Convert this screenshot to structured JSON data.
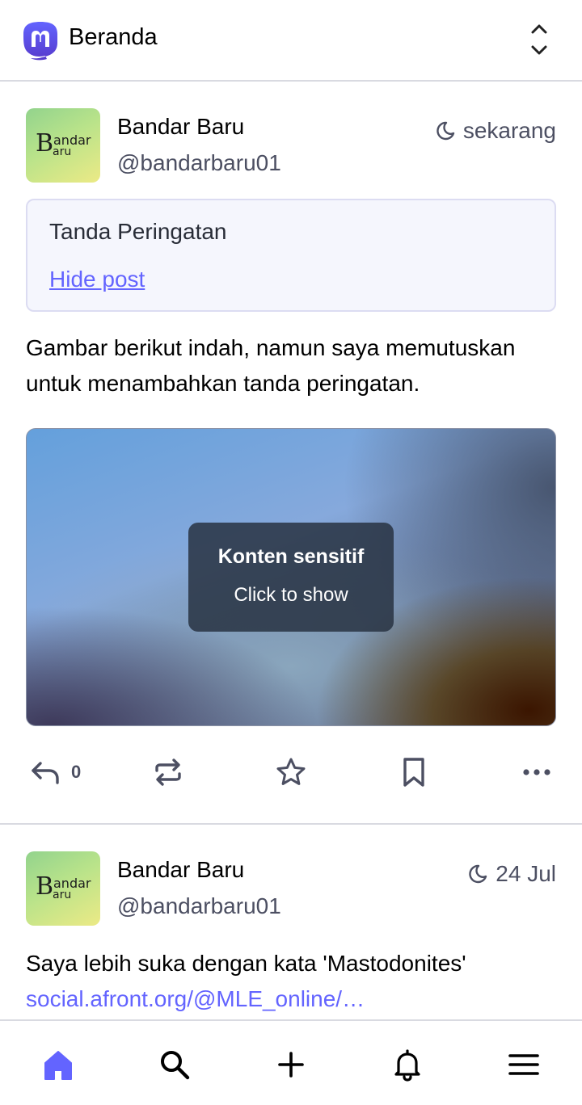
{
  "header": {
    "title": "Beranda",
    "logo_icon": "mastodon-logo",
    "toggle_icon": "chevron-up-down-icon"
  },
  "posts": [
    {
      "display_name": "Bandar Baru",
      "acct": "@bandarbaru01",
      "visibility_icon": "moon-icon",
      "time": "sekarang",
      "avatar": {
        "big": "B",
        "top": "andar",
        "bottom": "aru"
      },
      "content_warning": {
        "title": "Tanda Peringatan",
        "hide_link": "Hide post"
      },
      "text": "Gambar berikut indah, namun saya memutuskan untuk menambahkan tanda peringatan.",
      "media": {
        "title": "Konten sensitif",
        "subtitle": "Click to show"
      },
      "actions": {
        "reply_count": "0"
      }
    },
    {
      "display_name": "Bandar Baru",
      "acct": "@bandarbaru01",
      "visibility_icon": "moon-icon",
      "time": "24 Jul",
      "avatar": {
        "big": "B",
        "top": "andar",
        "bottom": "aru"
      },
      "text": "Saya lebih suka dengan kata 'Mastodonites'",
      "link": "social.afront.org/@MLE_online/…"
    }
  ],
  "bottom_nav": [
    "home-icon",
    "search-icon",
    "compose-icon",
    "notifications-icon",
    "menu-icon"
  ],
  "colors": {
    "accent": "#6364ff",
    "secondary_text": "#4c4f62",
    "divider": "#d9dae1"
  }
}
